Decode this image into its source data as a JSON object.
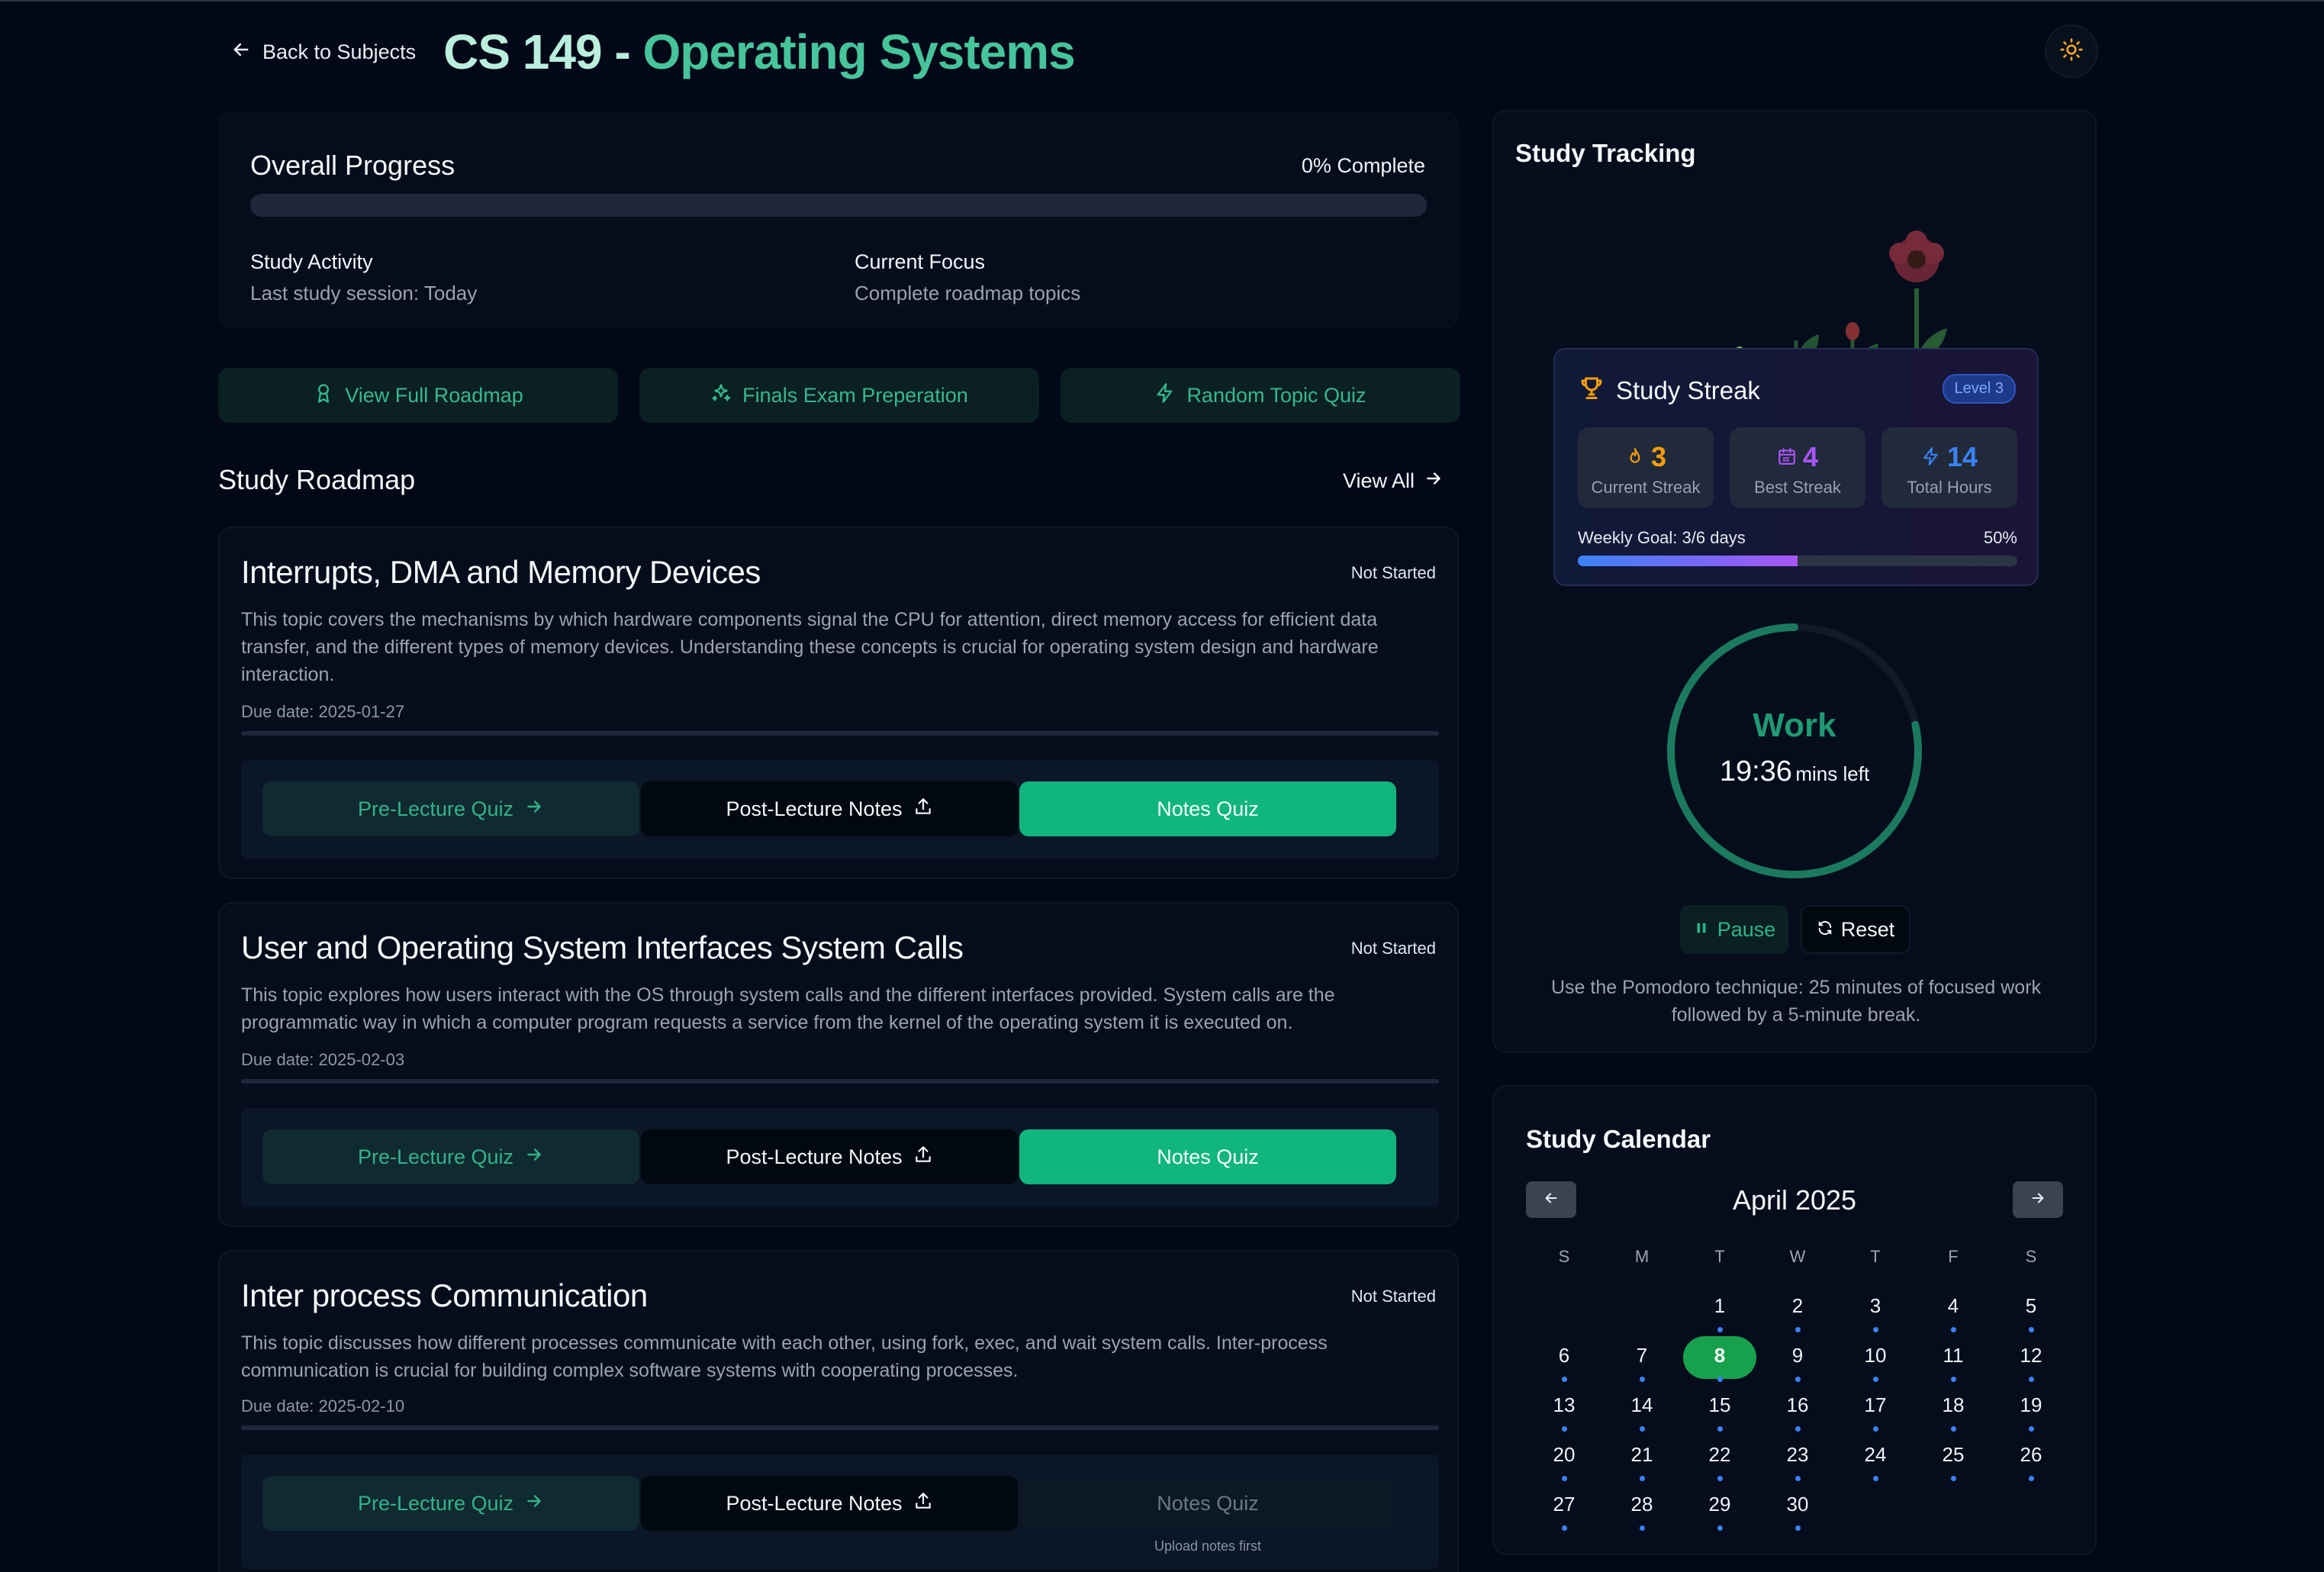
{
  "header": {
    "back_label": "Back to Subjects",
    "course_code": "CS 149 -",
    "course_name": "Operating Systems"
  },
  "overall": {
    "title": "Overall Progress",
    "percent_label": "0% Complete",
    "progress_fraction": 0.0,
    "activity_label": "Study Activity",
    "activity_value": "Last study session: Today",
    "focus_label": "Current Focus",
    "focus_value": "Complete roadmap topics"
  },
  "actions": {
    "roadmap": "View Full Roadmap",
    "finals": "Finals Exam Preperation",
    "quiz": "Random Topic Quiz"
  },
  "roadmap": {
    "title": "Study Roadmap",
    "view_all": "View All",
    "topics": [
      {
        "title": "Interrupts, DMA and Memory Devices",
        "status": "Not Started",
        "description": "This topic covers the mechanisms by which hardware components signal the CPU for attention, direct memory access for efficient data transfer, and the different types of memory devices. Understanding these concepts is crucial for operating system design and hardware interaction.",
        "due": "Due date: 2025-01-27",
        "progress_fraction": 0.0,
        "pre_quiz": "Pre-Lecture Quiz",
        "post_notes": "Post-Lecture Notes",
        "notes_quiz": "Notes Quiz"
      },
      {
        "title": "User and Operating System Interfaces System Calls",
        "status": "Not Started",
        "description": "This topic explores how users interact with the OS through system calls and the different interfaces provided. System calls are the programmatic way in which a computer program requests a service from the kernel of the operating system it is executed on.",
        "due": "Due date: 2025-02-03",
        "progress_fraction": 0.0,
        "pre_quiz": "Pre-Lecture Quiz",
        "post_notes": "Post-Lecture Notes",
        "notes_quiz": "Notes Quiz"
      },
      {
        "title": "Inter process Communication",
        "status": "Not Started",
        "description": "This topic discusses how different processes communicate with each other, using fork, exec, and wait system calls. Inter-process communication is crucial for building complex software systems with cooperating processes.",
        "due": "Due date: 2025-02-10",
        "progress_fraction": 0.0,
        "pre_quiz": "Pre-Lecture Quiz",
        "post_notes": "Post-Lecture Notes",
        "notes_quiz": "Notes Quiz",
        "notes_quiz_hint": "Upload notes first"
      }
    ]
  },
  "tracking": {
    "title": "Study Tracking",
    "streak": {
      "title": "Study Streak",
      "level": "Level 3",
      "current_value": "3",
      "current_label": "Current Streak",
      "best_value": "4",
      "best_label": "Best Streak",
      "hours_value": "14",
      "hours_label": "Total Hours",
      "weekly_label": "Weekly Goal: 3/6 days",
      "weekly_percent": "50%",
      "weekly_fraction": 0.5
    },
    "timer": {
      "mode": "Work",
      "time": "19:36",
      "unit": "mins left",
      "remaining_fraction": 0.784,
      "pause": "Pause",
      "reset": "Reset",
      "tip": "Use the Pomodoro technique: 25 minutes of focused work followed by a 5-minute break."
    }
  },
  "calendar": {
    "title": "Study Calendar",
    "month": "April 2025",
    "weekdays": [
      "S",
      "M",
      "T",
      "W",
      "T",
      "F",
      "S"
    ],
    "first_weekday": 2,
    "days_in_month": 30,
    "today": 8,
    "days_with_dots": [
      1,
      2,
      3,
      4,
      5,
      6,
      7,
      8,
      9,
      10,
      11,
      12,
      13,
      14,
      15,
      16,
      17,
      18,
      19,
      20,
      21,
      22,
      23,
      24,
      25,
      26,
      27,
      28,
      29,
      30
    ]
  },
  "colors": {
    "accent": "#46c49a",
    "accent_button": "#11b57e",
    "background": "#020817",
    "streak_blue": "#3b82f6",
    "streak_purple": "#a855f7",
    "today_green": "#18a14d",
    "trophy_orange": "#f59e0b"
  }
}
